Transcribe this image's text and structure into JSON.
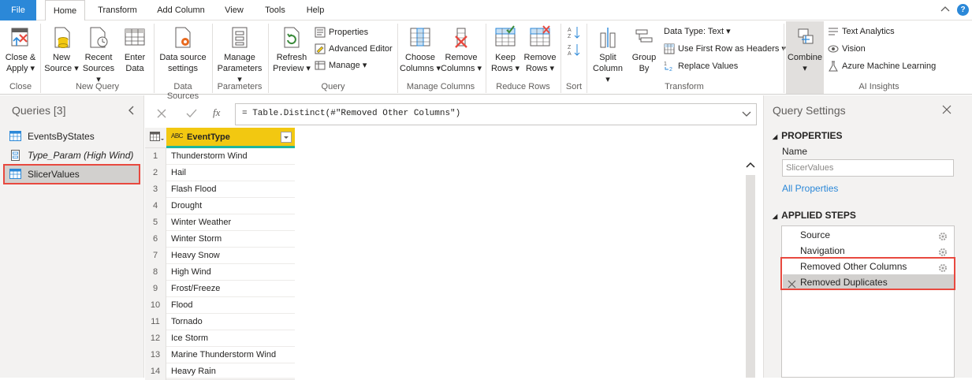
{
  "menu": {
    "tabs": [
      "File",
      "Home",
      "Transform",
      "Add Column",
      "View",
      "Tools",
      "Help"
    ],
    "help_icon": "?"
  },
  "ribbon": {
    "close_apply": [
      "Close &",
      "Apply"
    ],
    "new_source": [
      "New",
      "Source"
    ],
    "recent_sources": [
      "Recent",
      "Sources"
    ],
    "enter_data": [
      "Enter",
      "Data"
    ],
    "data_source_settings": [
      "Data source",
      "settings"
    ],
    "manage_parameters": [
      "Manage",
      "Parameters"
    ],
    "refresh_preview": [
      "Refresh",
      "Preview"
    ],
    "properties": "Properties",
    "advanced_editor": "Advanced Editor",
    "manage": "Manage",
    "choose_columns": [
      "Choose",
      "Columns"
    ],
    "remove_columns": [
      "Remove",
      "Columns"
    ],
    "keep_rows": [
      "Keep",
      "Rows"
    ],
    "remove_rows": [
      "Remove",
      "Rows"
    ],
    "split_column": [
      "Split",
      "Column"
    ],
    "group_by": [
      "Group",
      "By"
    ],
    "data_type": "Data Type: Text",
    "use_first_row": "Use First Row as Headers",
    "replace_values": "Replace Values",
    "combine": "Combine",
    "text_analytics": "Text Analytics",
    "vision": "Vision",
    "azure_ml": "Azure Machine Learning",
    "groups": {
      "close": "Close",
      "new_query": "New Query",
      "data_sources": "Data Sources",
      "parameters": "Parameters",
      "query": "Query",
      "manage_columns": "Manage Columns",
      "reduce_rows": "Reduce Rows",
      "sort": "Sort",
      "transform": "Transform",
      "ai_insights": "AI Insights"
    }
  },
  "queries": {
    "title": "Queries [3]",
    "items": [
      "EventsByStates",
      "Type_Param (High Wind)",
      "SlicerValues"
    ]
  },
  "formula": {
    "text": "= Table.Distinct(#\"Removed Other Columns\")",
    "fx": "fx"
  },
  "table": {
    "type_badge": "ABC",
    "column": "EventType",
    "rows": [
      {
        "n": "1",
        "v": "Thunderstorm Wind"
      },
      {
        "n": "2",
        "v": "Hail"
      },
      {
        "n": "3",
        "v": "Flash Flood"
      },
      {
        "n": "4",
        "v": "Drought"
      },
      {
        "n": "5",
        "v": "Winter Weather"
      },
      {
        "n": "6",
        "v": "Winter Storm"
      },
      {
        "n": "7",
        "v": "Heavy Snow"
      },
      {
        "n": "8",
        "v": "High Wind"
      },
      {
        "n": "9",
        "v": "Frost/Freeze"
      },
      {
        "n": "10",
        "v": "Flood"
      },
      {
        "n": "11",
        "v": "Tornado"
      },
      {
        "n": "12",
        "v": "Ice Storm"
      },
      {
        "n": "13",
        "v": "Marine Thunderstorm Wind"
      },
      {
        "n": "14",
        "v": "Heavy Rain"
      }
    ]
  },
  "settings": {
    "title": "Query Settings",
    "properties": "PROPERTIES",
    "name_label": "Name",
    "name_value": "SlicerValues",
    "all_properties": "All Properties",
    "applied_steps": "APPLIED STEPS",
    "steps": [
      "Source",
      "Navigation",
      "Removed Other Columns",
      "Removed Duplicates"
    ]
  },
  "colors": {
    "accent": "#2b88d8",
    "highlight": "#e8493f",
    "column_header": "#f2c811"
  }
}
